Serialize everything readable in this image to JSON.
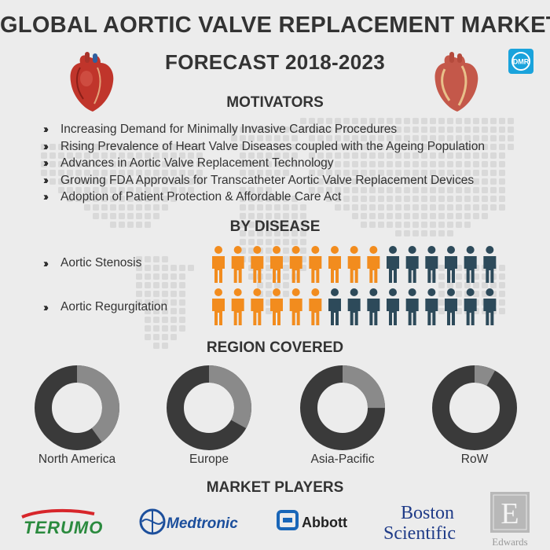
{
  "header": {
    "title_line1": "GLOBAL AORTIC VALVE REPLACEMENT MARKET",
    "title_line2": "FORECAST 2018-2023",
    "logo_text": "DMR"
  },
  "motivators": {
    "title": "MOTIVATORS",
    "items": [
      "Increasing Demand for Minimally Invasive Cardiac Procedures",
      "Rising Prevalence of Heart Valve Diseases coupled with the Ageing Population",
      "Advances in Aortic Valve Replacement Technology",
      "Growing FDA Approvals for Transcatheter Aortic Valve Replacement Devices",
      "Adoption of Patient Protection & Affordable Care Act"
    ]
  },
  "disease": {
    "title": "BY DISEASE",
    "rows": [
      {
        "label": "Aortic Stenosis",
        "highlighted": 9,
        "total": 15
      },
      {
        "label": "Aortic Regurgitation",
        "highlighted": 6,
        "total": 15
      }
    ],
    "highlight_color": "#f28c1e",
    "base_color": "#2d4a5a"
  },
  "regions": {
    "title": "REGION COVERED",
    "items": [
      {
        "label": "North America",
        "share": 0.4
      },
      {
        "label": "Europe",
        "share": 0.33
      },
      {
        "label": "Asia-Pacific",
        "share": 0.25
      },
      {
        "label": "RoW",
        "share": 0.08
      }
    ],
    "dark_color": "#3a3a3a",
    "light_color": "#8a8a8a"
  },
  "players": {
    "title": "MARKET PLAYERS",
    "terumo": "TERUMO",
    "medtronic": "Medtronic",
    "abbott": "Abbott",
    "boston_line1": "Boston",
    "boston_line2": "Scientific",
    "edwards": "Edwards",
    "edwards_mark": "E"
  }
}
